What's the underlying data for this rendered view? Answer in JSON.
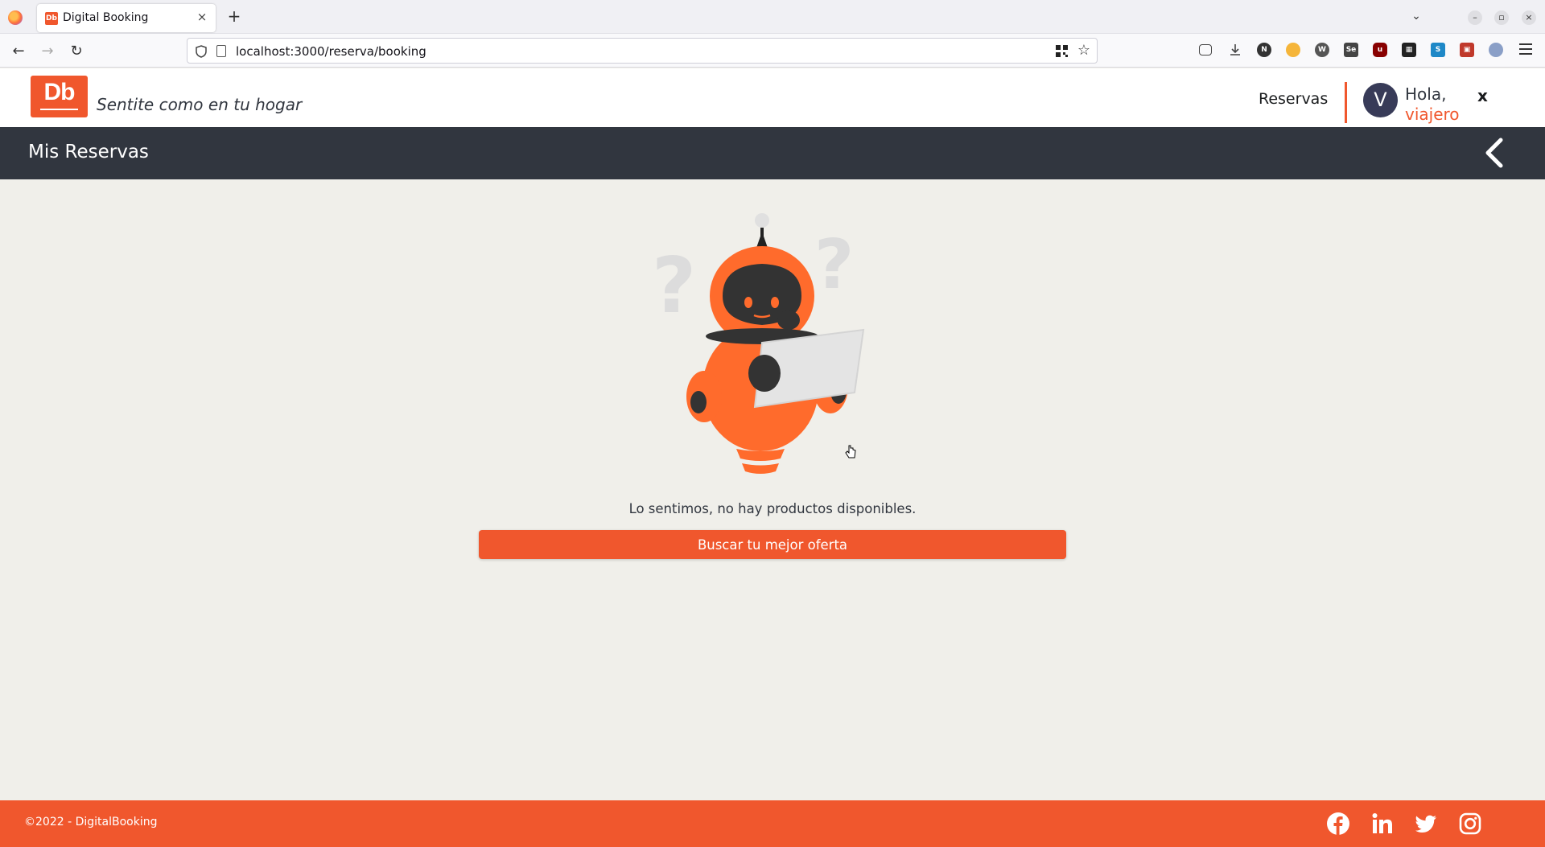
{
  "browser": {
    "tab_title": "Digital Booking",
    "favicon_text": "Db",
    "tab_close": "×",
    "new_tab": "+",
    "tab_list": "⌄",
    "url": "localhost:3000/reserva/booking",
    "win_minimize": "–",
    "win_restore": "▫",
    "win_close": "×",
    "back": "←",
    "forward": "→",
    "reload": "↻",
    "star": "☆",
    "toolbar_icons": [
      "pocket-icon",
      "download-icon",
      "n-extension-icon",
      "emoji-extension-icon",
      "wordpress-extension-icon",
      "selenium-extension-icon",
      "ublock-icon",
      "apps-extension-icon",
      "s-extension-icon",
      "extension-red-icon",
      "extension-puzzle-icon"
    ]
  },
  "header": {
    "logo_text": "Db",
    "slogan": "Sentite como en tu hogar",
    "reservas_link": "Reservas",
    "avatar_initial": "V",
    "greeting": "Hola,",
    "username": "viajero",
    "close_label": "x"
  },
  "titlebar": {
    "title": "Mis Reservas"
  },
  "main": {
    "empty_message": "Lo sentimos, no hay productos disponibles.",
    "cta_label": "Buscar tu mejor oferta"
  },
  "footer": {
    "copyright": "©2022 - DigitalBooking",
    "social": [
      "facebook-icon",
      "linkedin-icon",
      "twitter-icon",
      "instagram-icon"
    ]
  },
  "colors": {
    "brand": "#f0572d",
    "dark": "#31363f",
    "background": "#f0efea"
  }
}
